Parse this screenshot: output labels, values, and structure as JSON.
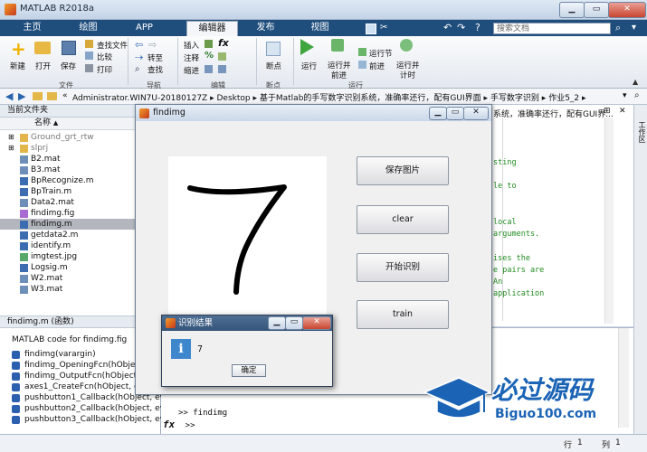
{
  "window": {
    "title": "MATLAB R2018a"
  },
  "ribbon_tabs": [
    "主页",
    "绘图",
    "APP",
    "编辑器",
    "发布",
    "视图"
  ],
  "search_docs": {
    "placeholder": "搜索文档"
  },
  "ribbon": {
    "file": {
      "new": "新建",
      "open": "打开",
      "save": "保存",
      "find_files": "查找文件",
      "compare": "比较",
      "print": "打印",
      "group": "文件"
    },
    "nav": {
      "goto": "转至",
      "find": "查找",
      "group": "导航"
    },
    "edit": {
      "insert": "插入",
      "comment": "注释",
      "indent": "缩进",
      "group": "编辑"
    },
    "breakpoints": {
      "label": "断点",
      "group": "断点"
    },
    "run": {
      "run": "运行",
      "run_advance_1": "运行并",
      "run_advance_2": "前进",
      "run_section": "运行节",
      "advance": "前进",
      "run_time_1": "运行并",
      "run_time_2": "计时",
      "group": "运行"
    }
  },
  "address": {
    "segments": [
      "Administrator.WIN7U-20180127Z",
      "Desktop",
      "基于Matlab的手写数字识别系统，准确率还行，配有GUI界面",
      "手写数字识别",
      "作业5_2"
    ]
  },
  "current_folder": {
    "title": "当前文件夹",
    "column_name": "名称",
    "items": [
      {
        "name": "Ground_grt_rtw",
        "type": "folder"
      },
      {
        "name": "slprj",
        "type": "folder"
      },
      {
        "name": "B2.mat",
        "type": "mat"
      },
      {
        "name": "B3.mat",
        "type": "mat"
      },
      {
        "name": "BpRecognize.m",
        "type": "m"
      },
      {
        "name": "BpTrain.m",
        "type": "m"
      },
      {
        "name": "Data2.mat",
        "type": "mat"
      },
      {
        "name": "findimg.fig",
        "type": "fig"
      },
      {
        "name": "findimg.m",
        "type": "m",
        "selected": true
      },
      {
        "name": "getdata2.m",
        "type": "m"
      },
      {
        "name": "identify.m",
        "type": "m"
      },
      {
        "name": "imgtest.jpg",
        "type": "jpg"
      },
      {
        "name": "Logsig.m",
        "type": "m"
      },
      {
        "name": "W2.mat",
        "type": "mat"
      },
      {
        "name": "W3.mat",
        "type": "mat"
      }
    ]
  },
  "details": {
    "header": "findimg.m  (函数)",
    "description": "MATLAB code for findimg.fig",
    "functions": [
      "findimg(varargin)",
      "findimg_OpeningFcn(hObject, eventdata, handles, varargin)",
      "findimg_OutputFcn(hObject, eventdata, handles)",
      "axes1_CreateFcn(hObject, eventdata, handles)",
      "pushbutton1_Callback(hObject, eventdata, handles)",
      "pushbutton2_Callback(hObject, eventdata, handles)",
      "pushbutton3_Callback(hObject, eventdata, handles)"
    ]
  },
  "editor_tab_title": "系统，准确率还行，配有GUI界...",
  "editor_code_lines": [
    "sting",
    "",
    "le to",
    "",
    "",
    " local",
    "arguments.",
    "",
    "ises the",
    "e pairs are",
    " An",
    " application"
  ],
  "command_window": {
    "prompt": ">>",
    "last_command": "findimg"
  },
  "status": {
    "row_label": "行",
    "row": "1",
    "col_label": "列",
    "col": "1"
  },
  "figure": {
    "title": "findimg",
    "digit": "7",
    "buttons": [
      "保存图片",
      "clear",
      "开始识别",
      "train"
    ]
  },
  "dialog": {
    "title": "识别结果",
    "message": "7",
    "ok": "确定"
  },
  "watermark": {
    "cn": "必过源码",
    "en": "Biguo100.com"
  },
  "colors": {
    "tab_bar": "#1f4e7d",
    "accent": "#2c5fae",
    "watermark_blue": "#1b63b5"
  }
}
